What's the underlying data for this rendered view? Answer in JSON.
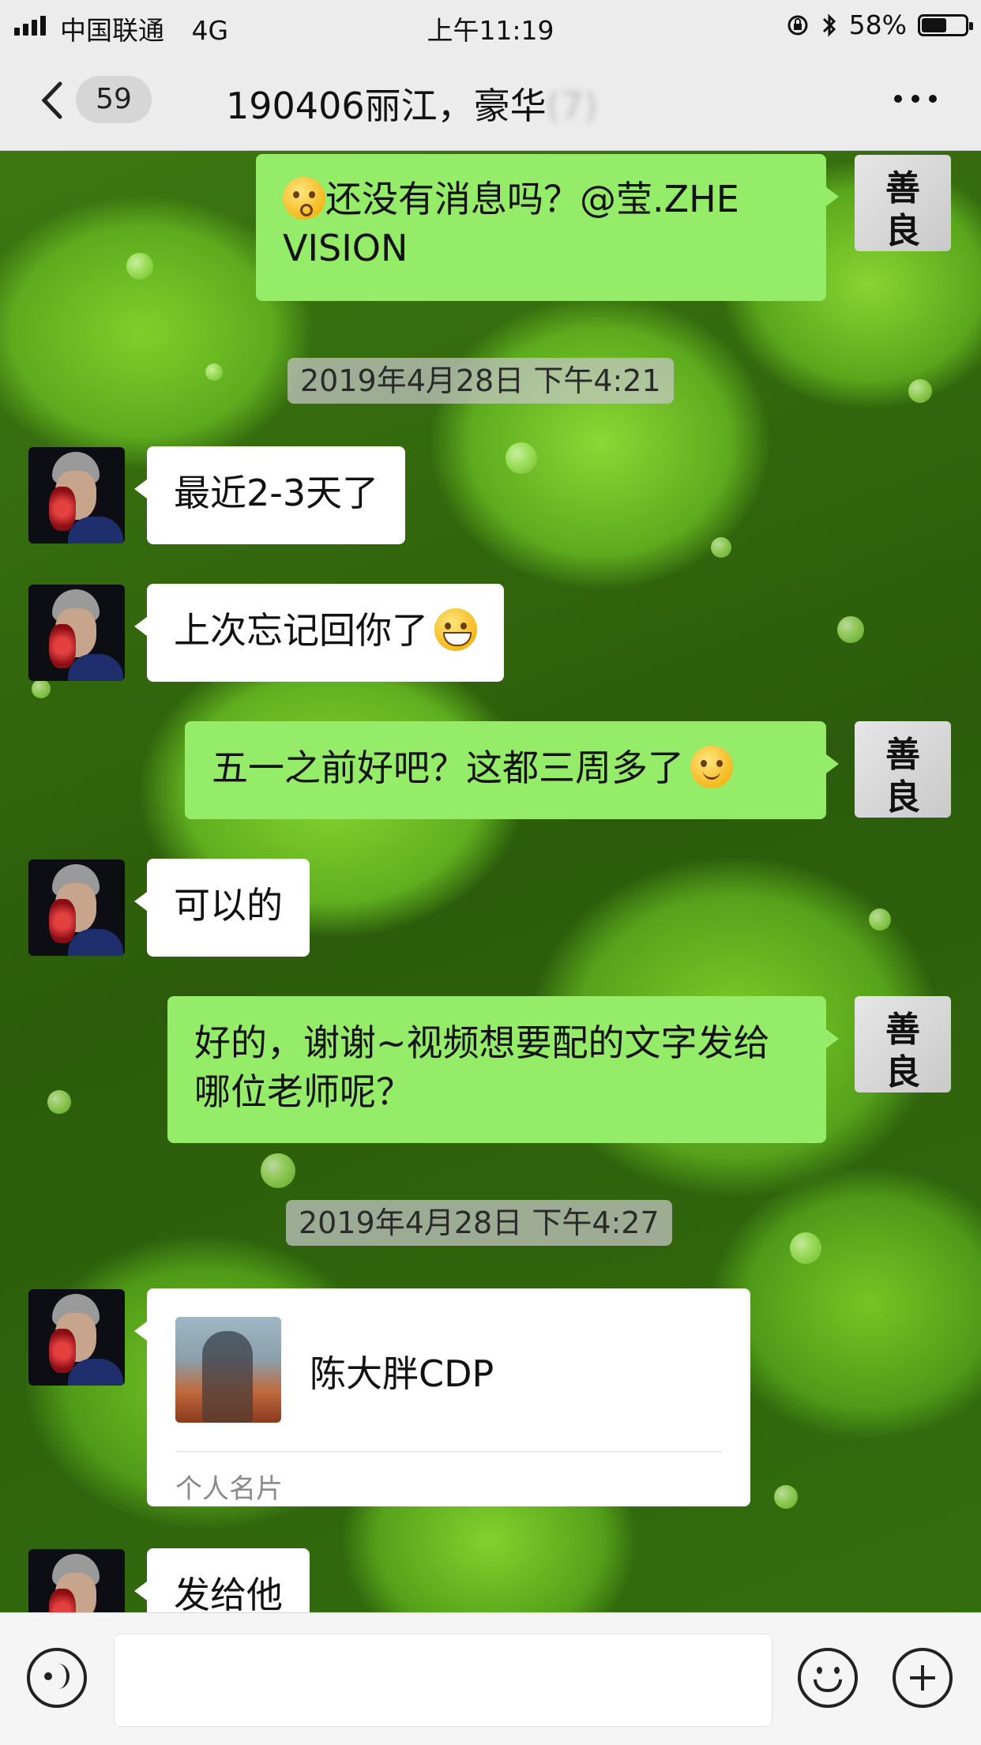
{
  "status_bar": {
    "carrier": "中国联通",
    "network": "4G",
    "time": "上午11:19",
    "battery_percent": "58%",
    "battery_level": 0.58
  },
  "nav": {
    "back_icon": "chevron-left-icon",
    "unread_count": "59",
    "title_visible": "190406丽江，豪华",
    "title_obscured": "(7)",
    "more_icon": "ellipsis-icon"
  },
  "self_avatar": {
    "line1": "善",
    "line2": "良"
  },
  "messages": [
    {
      "sender": "self",
      "text": "还没有消息吗？@莹.ZHE VISION",
      "emoji": "flushed-face-emoji"
    },
    {
      "type": "timestamp",
      "text": "2019年4月28日 下午4:21"
    },
    {
      "sender": "other",
      "text": "最近2-3天了"
    },
    {
      "sender": "other",
      "text": "上次忘记回你了",
      "emoji": "grinning-face-emoji"
    },
    {
      "sender": "self",
      "text": "五一之前好吧？这都三周多了",
      "emoji": "smiling-face-emoji"
    },
    {
      "sender": "other",
      "text": "可以的"
    },
    {
      "sender": "self",
      "text": "好的，谢谢~视频想要配的文字发给哪位老师呢？"
    },
    {
      "type": "timestamp",
      "text": "2019年4月28日 下午4:27"
    },
    {
      "sender": "other",
      "type": "contact_card",
      "name": "陈大胖CDP",
      "label": "个人名片"
    },
    {
      "sender": "other",
      "text": "发给他"
    }
  ],
  "input_bar": {
    "voice_icon": "voice-icon",
    "text_value": "",
    "emoji_icon": "emoji-icon",
    "plus_icon": "plus-icon"
  },
  "colors": {
    "self_bubble": "#95ec69",
    "other_bubble": "#ffffff",
    "nav_background": "#ececec"
  }
}
